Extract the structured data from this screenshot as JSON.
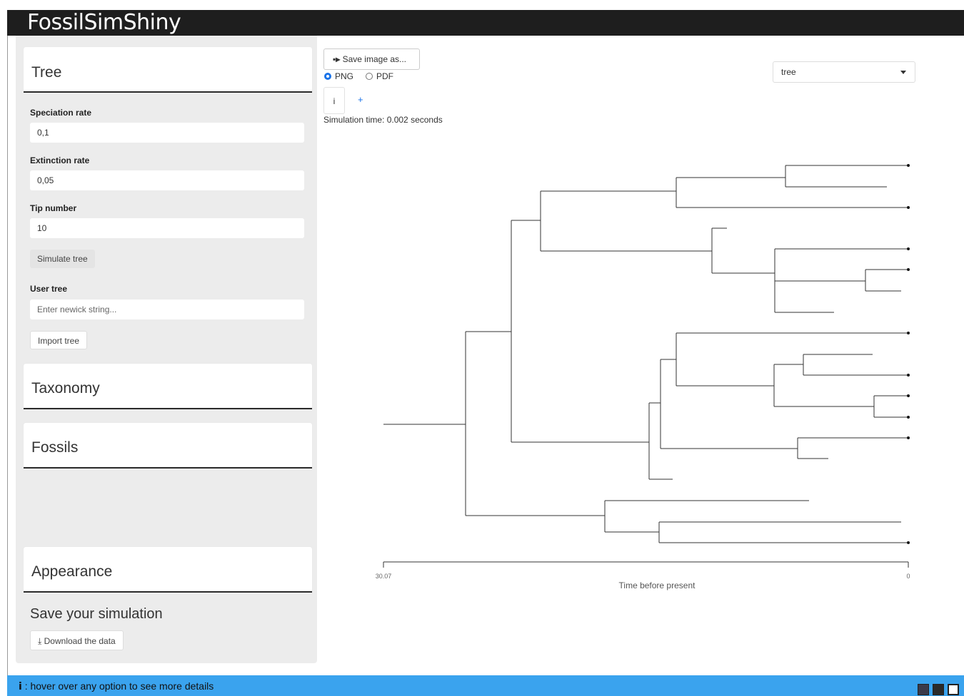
{
  "app": {
    "title": "FossilSimShiny"
  },
  "sidebar": {
    "tree_panel": {
      "title": "Tree"
    },
    "speciation": {
      "label": "Speciation rate",
      "value": "0,1"
    },
    "extinction": {
      "label": "Extinction rate",
      "value": "0,05"
    },
    "tip_number": {
      "label": "Tip number",
      "value": "10"
    },
    "simulate_button": "Simulate tree",
    "user_tree": {
      "label": "User tree",
      "placeholder": "Enter newick string..."
    },
    "import_button": "Import tree",
    "taxonomy_panel": {
      "title": "Taxonomy"
    },
    "fossils_panel": {
      "title": "Fossils"
    },
    "appearance_panel": {
      "title": "Appearance"
    },
    "save_section": {
      "title": "Save your simulation",
      "download_button": "Download the data"
    }
  },
  "main": {
    "save_image_button": "Save image as...",
    "format_options": [
      {
        "label": "PNG",
        "selected": true
      },
      {
        "label": "PDF",
        "selected": false
      }
    ],
    "info_button": "i",
    "plus_button": "+",
    "sim_time": "Simulation time: 0.002 seconds",
    "view_select": {
      "value": "tree"
    }
  },
  "plot": {
    "axis_label": "Time before present",
    "axis_min_label": "30.07",
    "axis_max_label": "0"
  },
  "footer": {
    "icon": "i",
    "text": " : hover over any option to see more details",
    "squares": [
      "#3a3a4a",
      "#2a2a2a",
      "#ffffff"
    ]
  }
}
